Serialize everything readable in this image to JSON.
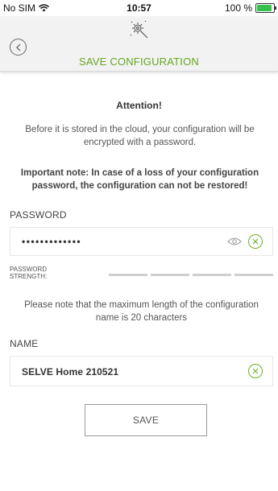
{
  "status_bar": {
    "carrier": "No SIM",
    "time": "10:57",
    "battery_text": "100 %",
    "battery_level": 1.0,
    "battery_color": "#35c24a"
  },
  "header": {
    "title": "SAVE CONFIGURATION",
    "title_color": "#66a61e",
    "back_icon": "chevron-left-icon",
    "config_icon": "gear-wand-icon"
  },
  "content": {
    "attention": "Attention!",
    "description": "Before it is stored in the cloud, your configuration will be encrypted with a password.",
    "important_note": "Important note: In case of a loss of your configuration password, the configuration can not be restored!",
    "password": {
      "label": "PASSWORD",
      "value": "•••••••••••••",
      "show_icon": "eye-icon",
      "clear_icon": "clear-icon"
    },
    "strength": {
      "label_line1": "PASSWORD",
      "label_line2": "STRENGTH:",
      "segments_filled": 0,
      "segments_total": 4
    },
    "name_note": "Please note that the maximum length of the configuration name is 20 characters",
    "name": {
      "label": "NAME",
      "value": "SELVE Home 210521",
      "clear_icon": "clear-icon"
    },
    "save_label": "SAVE",
    "accent_color": "#6bb324"
  }
}
